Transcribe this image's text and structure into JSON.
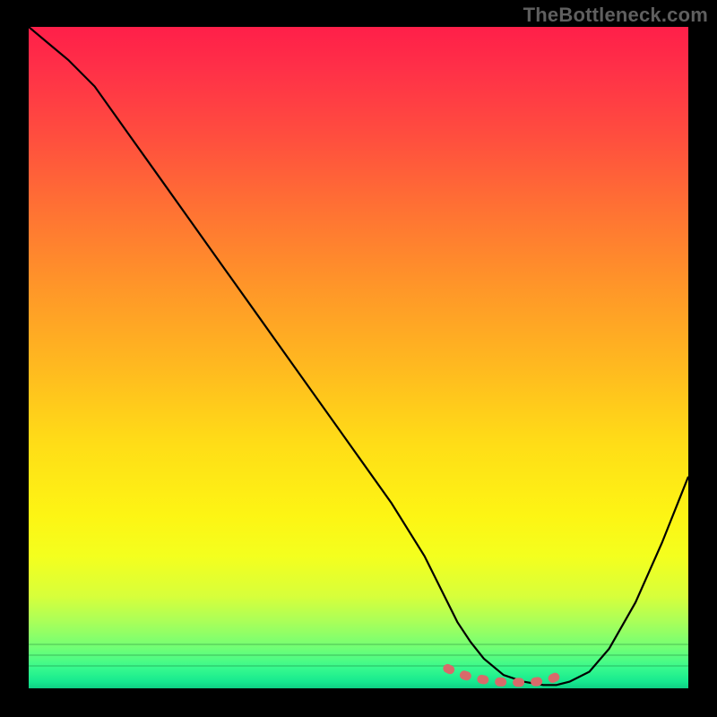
{
  "watermark": "TheBottleneck.com",
  "chart_data": {
    "type": "line",
    "title": "",
    "xlabel": "",
    "ylabel": "",
    "xlim": [
      0,
      100
    ],
    "ylim": [
      0,
      100
    ],
    "series": [
      {
        "name": "curve",
        "x": [
          0,
          3,
          6,
          10,
          15,
          20,
          25,
          30,
          35,
          40,
          45,
          50,
          55,
          60,
          63,
          65,
          67,
          69,
          72,
          75,
          78,
          80,
          82,
          85,
          88,
          92,
          96,
          100
        ],
        "y": [
          100,
          97.5,
          95,
          91,
          84,
          77,
          70,
          63,
          56,
          49,
          42,
          35,
          28,
          20,
          14,
          10,
          7,
          4.5,
          2,
          1,
          0.5,
          0.5,
          1,
          2.5,
          6,
          13,
          22,
          32
        ],
        "color": "#000000"
      },
      {
        "name": "highlight",
        "x": [
          63.5,
          65,
          67,
          69,
          71,
          73,
          75,
          77,
          79,
          80.5
        ],
        "y": [
          3.0,
          2.3,
          1.7,
          1.3,
          1.0,
          0.9,
          0.9,
          1.0,
          1.3,
          2.0
        ],
        "color": "#d86a6a",
        "style": "thick-dash"
      }
    ],
    "gradient_stops": [
      {
        "pos": 0,
        "color": "#ff1f49"
      },
      {
        "pos": 16,
        "color": "#ff4c3f"
      },
      {
        "pos": 40,
        "color": "#ff9828"
      },
      {
        "pos": 63,
        "color": "#ffdd17"
      },
      {
        "pos": 80,
        "color": "#f4ff1e"
      },
      {
        "pos": 94,
        "color": "#6fff76"
      },
      {
        "pos": 100,
        "color": "#0fcf84"
      }
    ]
  }
}
